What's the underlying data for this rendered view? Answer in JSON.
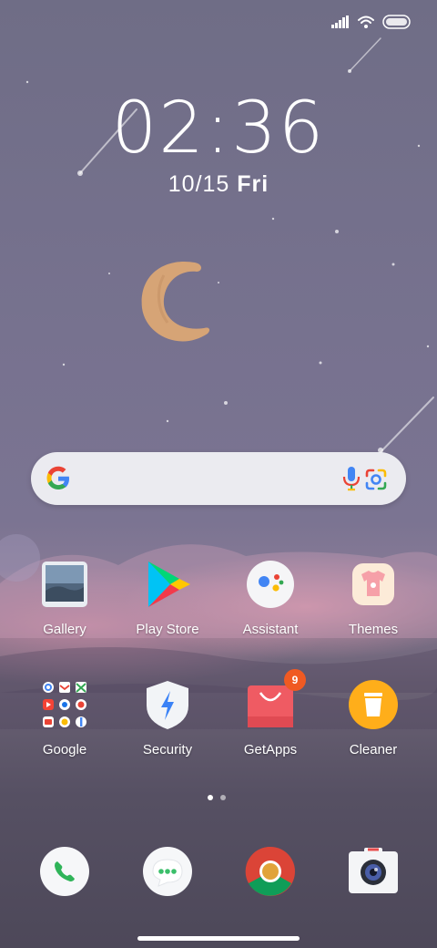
{
  "status_bar": {
    "icons": [
      "signal-icon",
      "wifi-icon",
      "battery-icon"
    ]
  },
  "lockscreen": {
    "time": "02:36",
    "date": "10/15",
    "day": "Fri"
  },
  "search_bar": {
    "icons": [
      "google-g-icon",
      "microphone-icon",
      "google-lens-icon"
    ]
  },
  "apps_row1": [
    {
      "label": "Gallery",
      "icon": "gallery-icon"
    },
    {
      "label": "Play Store",
      "icon": "play-store-icon"
    },
    {
      "label": "Assistant",
      "icon": "assistant-icon"
    },
    {
      "label": "Themes",
      "icon": "themes-icon"
    }
  ],
  "apps_row2": [
    {
      "label": "Google",
      "icon": "google-folder-icon"
    },
    {
      "label": "Security",
      "icon": "security-icon"
    },
    {
      "label": "GetApps",
      "icon": "getapps-icon",
      "badge": "9"
    },
    {
      "label": "Cleaner",
      "icon": "cleaner-icon"
    }
  ],
  "page_indicator": {
    "pages": 2,
    "current": 1
  },
  "dock": [
    {
      "icon": "phone-icon"
    },
    {
      "icon": "messages-icon"
    },
    {
      "icon": "chrome-icon"
    },
    {
      "icon": "camera-icon"
    }
  ],
  "colors": {
    "badge": "#f05a22",
    "moon": "#d6a476",
    "search_bg": "#f1f1f6"
  }
}
